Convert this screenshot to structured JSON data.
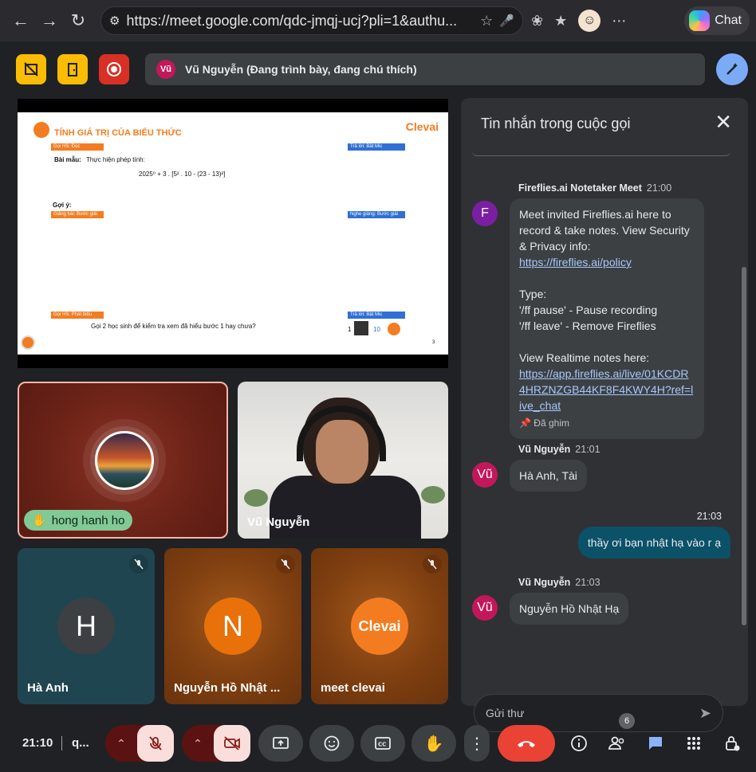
{
  "browser": {
    "url": "https://meet.google.com/qdc-jmqj-ucj?pli=1&authu...",
    "chat_label": "Chat"
  },
  "top": {
    "presenting_badge": "Vũ",
    "presenting_text": "Vũ Nguyễn (Đang trình bày, đang chú thích)"
  },
  "slide": {
    "title": "TÍNH GIÁ TRỊ CỦA BIỂU THỨC",
    "logo": "Clevai",
    "tag1": "Gọi HS: Đọc",
    "tag2": "Trả lời: Bắt Mic",
    "example_label": "Bài mẫu:",
    "example_text": "Thực hiện phép tính:",
    "expression": "2025⁰ + 3 . [5² . 10 - (23 - 13)²]",
    "hint_label": "Gợi ý:",
    "tag3": "Giảng bài: Bước giải",
    "tag4": "Nghe giảng: Bước giải",
    "tag5": "Gọi HS: Phát biểu",
    "tag6": "Trả lời: Bật Mic",
    "question": "Gọi 2 học sinh để kiểm tra xem đã hiểu bước 1 hay chưa?",
    "reward_left": "1",
    "reward_right": "10",
    "page_no": "3"
  },
  "tiles": [
    {
      "name": "hong hanh ho"
    },
    {
      "name": "Vũ Nguyễn"
    },
    {
      "name": "Hà Anh",
      "initial": "H"
    },
    {
      "name": "Nguyễn Hồ Nhật ...",
      "initial": "N"
    },
    {
      "name": "meet clevai",
      "initial": "Clevai"
    }
  ],
  "chat": {
    "header": "Tin nhắn trong cuộc gọi",
    "messages": [
      {
        "sender": "Fireflies.ai Notetaker Meet",
        "time": "21:00",
        "avatar": "F",
        "line1": "Meet invited Fireflies.ai here to record & take notes. View Security & Privacy info:",
        "link1": "https://fireflies.ai/policy",
        "type_label": "Type:",
        "cmd1": "'/ff pause' - Pause recording",
        "cmd2": "'/ff leave' - Remove Fireflies",
        "line2": "View Realtime notes here:",
        "link2": "https://app.fireflies.ai/live/01KCDR4HRZNZGB44KF8F4KWY4H?ref=live_chat",
        "pinned": "Đã ghim"
      },
      {
        "sender": "Vũ Nguyễn",
        "time": "21:01",
        "avatar": "Vũ",
        "text": "Hà Anh, Tài"
      },
      {
        "time": "21:03",
        "text": "thầy ơi bạn nhật hạ vào r ạ"
      },
      {
        "sender": "Vũ Nguyễn",
        "time": "21:03",
        "avatar": "Vũ",
        "text": "Nguyễn Hồ Nhật Hạ"
      }
    ],
    "placeholder": "Gửi thư"
  },
  "controls": {
    "clock": "21:10",
    "meeting_code": "q...",
    "participant_count": "6"
  },
  "colors": {
    "accent": "#ea4335",
    "clevai_orange": "#f47c20",
    "chat_bg": "#303134",
    "bg": "#202124"
  }
}
